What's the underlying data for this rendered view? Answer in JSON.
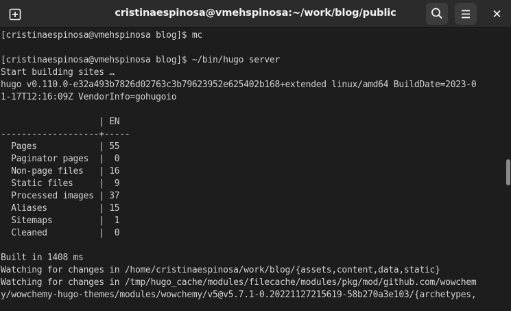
{
  "window": {
    "title": "cristinaespinosa@vmehspinosa:~/work/blog/public",
    "colors": {
      "background": "#1d1d1d",
      "titlebar": "#2b2b2b",
      "text": "#d0d0d0",
      "title_text": "#f2f2f2"
    }
  },
  "titlebar": {
    "new_tab_icon": "new-tab-icon",
    "search_icon": "search-icon",
    "menu_icon": "hamburger-menu-icon",
    "close_icon": "close-icon"
  },
  "terminal": {
    "lines": [
      "[cristinaespinosa@vmehspinosa blog]$ mc",
      "",
      "[cristinaespinosa@vmehspinosa blog]$ ~/bin/hugo server",
      "Start building sites …",
      "hugo v0.110.0-e32a493b7826d02763c3b79623952e625402b168+extended linux/amd64 BuildDate=2023-0",
      "1-17T12:16:09Z VendorInfo=gohugoio",
      "",
      "                   | EN",
      "-------------------+-----",
      "  Pages            | 55",
      "  Paginator pages  |  0",
      "  Non-page files   | 16",
      "  Static files     |  9",
      "  Processed images | 37",
      "  Aliases          | 15",
      "  Sitemaps         |  1",
      "  Cleaned          |  0",
      "",
      "Built in 1408 ms",
      "Watching for changes in /home/cristinaespinosa/work/blog/{assets,content,data,static}",
      "Watching for changes in /tmp/hugo_cache/modules/filecache/modules/pkg/mod/github.com/wowchem",
      "y/wowchemy-hugo-themes/modules/wowchemy/v5@v5.7.1-0.20221127215619-58b270a3e103/{archetypes,"
    ]
  }
}
